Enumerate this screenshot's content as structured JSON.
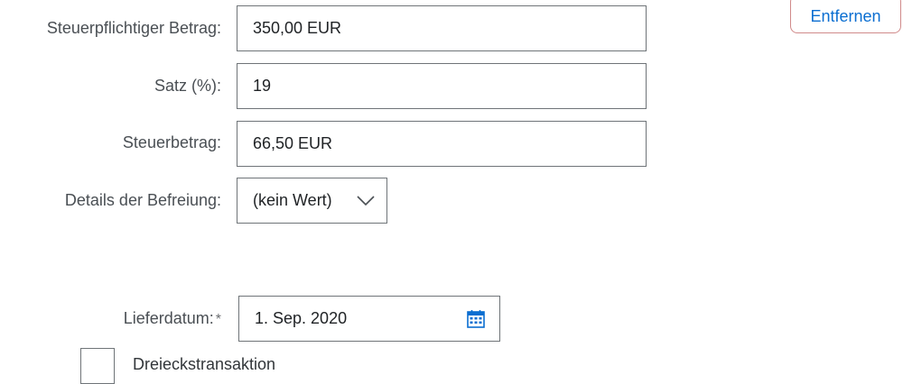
{
  "actions": {
    "remove_label": "Entfernen"
  },
  "form": {
    "taxable_amount": {
      "label": "Steuerpflichtiger Betrag:",
      "value": "350,00 EUR"
    },
    "rate": {
      "label": "Satz (%):",
      "value": "19"
    },
    "tax_amount": {
      "label": "Steuerbetrag:",
      "value": "66,50 EUR"
    },
    "exemption_details": {
      "label": "Details der Befreiung:",
      "value": "(kein Wert)"
    },
    "delivery_date": {
      "label": "Lieferdatum:",
      "required_marker": "*",
      "value": "1. Sep. 2020"
    },
    "triangular_transaction": {
      "label": "Dreieckstransaktion",
      "checked": false
    }
  },
  "colors": {
    "link_blue": "#0a6ed1",
    "remove_border": "#d08a8a",
    "field_border": "#6f7478",
    "calendar_blue": "#0a6ed1"
  },
  "icons": {
    "dropdown": "chevron-down-icon",
    "date": "calendar-icon"
  }
}
